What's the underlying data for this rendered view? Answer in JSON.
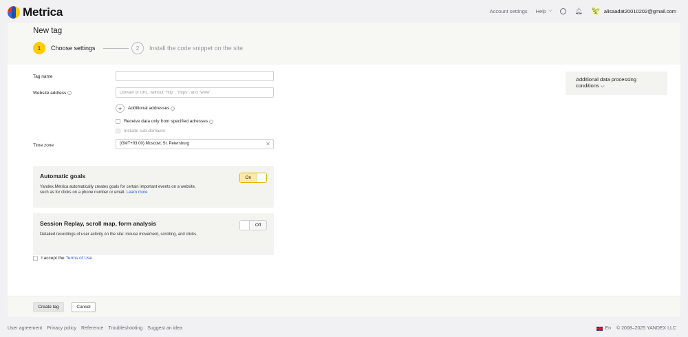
{
  "header": {
    "logo_text": "Metrica",
    "account_settings": "Account settings",
    "help": "Help",
    "email": "alisaadat20010202@gmail.com"
  },
  "page": {
    "title": "New tag",
    "steps": [
      {
        "number": "1",
        "label": "Choose settings"
      },
      {
        "number": "2",
        "label": "Install the code snippet on the site"
      }
    ]
  },
  "form": {
    "tag_name_label": "Tag name",
    "tag_name_value": "",
    "website_label": "Website address",
    "website_placeholder": "Domain or URL, without \"http\", \"https\", and \"www\"",
    "additional_addresses": "Additional addresses",
    "receive_only_label": "Receive data only from specified adresses",
    "include_subdomains_label": "Include sub-domains",
    "timezone_label": "Time zone",
    "timezone_value": "(GMT+03:00) Moscow, St. Petersburg"
  },
  "goals_panel": {
    "title": "Automatic goals",
    "desc_line1": "Yandex.Metrica automatically creates goals for certain important events on a website,",
    "desc_line2": "such as for clicks on a phone number or email.",
    "learn_more": "Learn more",
    "toggle_label": "On"
  },
  "replay_panel": {
    "title": "Session Replay, scroll map, form analysis",
    "desc": "Detailed recordings of user activity on the site: mouse movement, scrolling, and clicks.",
    "toggle_label": "Off"
  },
  "terms": {
    "prefix": "I accept the",
    "link": "Terms of Use"
  },
  "side": {
    "line1": "Additional data processing",
    "line2": "conditions"
  },
  "buttons": {
    "create": "Create tag",
    "cancel": "Cancel"
  },
  "footer": {
    "links": [
      "User agreement",
      "Privacy policy",
      "Reference",
      "Troubleshooting",
      "Suggest an idea"
    ],
    "lang": "En",
    "copyright": "© 2008–2025 YANDEX LLC"
  },
  "colors": {
    "accent_yellow": "#ffcc00",
    "link_blue": "#2a5bd7",
    "background": "#f1f1f4"
  }
}
